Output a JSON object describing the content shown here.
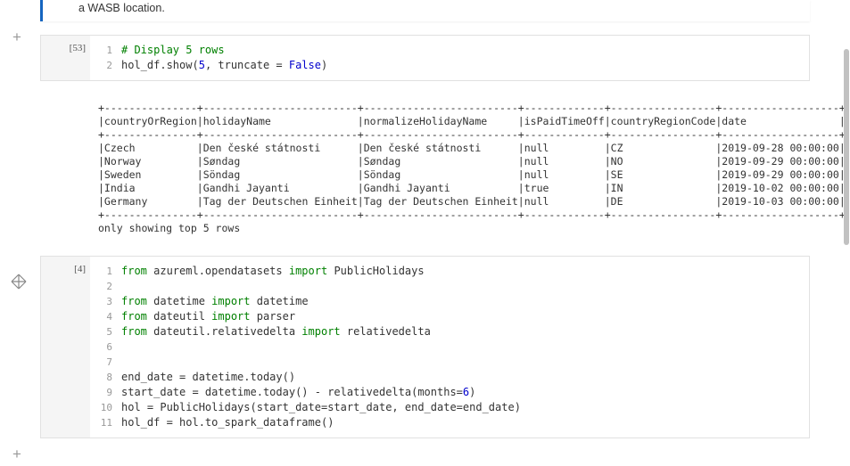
{
  "md_text": "a WASB location.",
  "cells": [
    {
      "prompt": "[53]",
      "lines": [
        {
          "n": "1",
          "tokens": [
            {
              "t": "# Display 5 rows",
              "cls": "cm-kw"
            }
          ]
        },
        {
          "n": "2",
          "tokens": [
            {
              "t": "hol_df.show("
            },
            {
              "t": "5",
              "cls": "cm-bi"
            },
            {
              "t": ", truncate = "
            },
            {
              "t": "False",
              "cls": "cm-bi"
            },
            {
              "t": ")"
            }
          ]
        }
      ]
    },
    {
      "prompt": "[4]",
      "lines": [
        {
          "n": "1",
          "tokens": [
            {
              "t": "from",
              "cls": "cm-kw"
            },
            {
              "t": " azureml.opendatasets "
            },
            {
              "t": "import",
              "cls": "cm-kw"
            },
            {
              "t": " PublicHolidays"
            }
          ]
        },
        {
          "n": "2",
          "tokens": []
        },
        {
          "n": "3",
          "tokens": [
            {
              "t": "from",
              "cls": "cm-kw"
            },
            {
              "t": " datetime "
            },
            {
              "t": "import",
              "cls": "cm-kw"
            },
            {
              "t": " datetime"
            }
          ]
        },
        {
          "n": "4",
          "tokens": [
            {
              "t": "from",
              "cls": "cm-kw"
            },
            {
              "t": " dateutil "
            },
            {
              "t": "import",
              "cls": "cm-kw"
            },
            {
              "t": " parser"
            }
          ]
        },
        {
          "n": "5",
          "tokens": [
            {
              "t": "from",
              "cls": "cm-kw"
            },
            {
              "t": " dateutil.relativedelta "
            },
            {
              "t": "import",
              "cls": "cm-kw"
            },
            {
              "t": " relativedelta"
            }
          ]
        },
        {
          "n": "6",
          "tokens": []
        },
        {
          "n": "7",
          "tokens": []
        },
        {
          "n": "8",
          "tokens": [
            {
              "t": "end_date = datetime.today()"
            }
          ]
        },
        {
          "n": "9",
          "tokens": [
            {
              "t": "start_date = datetime.today() - relativedelta(months="
            },
            {
              "t": "6",
              "cls": "cm-bi"
            },
            {
              "t": ")"
            }
          ]
        },
        {
          "n": "10",
          "tokens": [
            {
              "t": "hol = PublicHolidays(start_date=start_date, end_date=end_date)"
            }
          ]
        },
        {
          "n": "11",
          "tokens": [
            {
              "t": "hol_df = hol.to_spark_dataframe()"
            }
          ]
        }
      ]
    }
  ],
  "table": {
    "headers": [
      "countryOrRegion",
      "holidayName",
      "normalizeHolidayName",
      "isPaidTimeOff",
      "countryRegionCode",
      "date"
    ],
    "rows": [
      [
        "Czech",
        "Den české státnosti",
        "Den české státnosti",
        "null",
        "CZ",
        "2019-09-28 00:00:00"
      ],
      [
        "Norway",
        "Søndag",
        "Søndag",
        "null",
        "NO",
        "2019-09-29 00:00:00"
      ],
      [
        "Sweden",
        "Söndag",
        "Söndag",
        "null",
        "SE",
        "2019-09-29 00:00:00"
      ],
      [
        "India",
        "Gandhi Jayanti",
        "Gandhi Jayanti",
        "true",
        "IN",
        "2019-10-02 00:00:00"
      ],
      [
        "Germany",
        "Tag der Deutschen Einheit",
        "Tag der Deutschen Einheit",
        "null",
        "DE",
        "2019-10-03 00:00:00"
      ]
    ],
    "footer": "only showing top 5 rows"
  },
  "chart_data": {
    "type": "table",
    "title": "Public Holidays (top 5 rows)",
    "columns": [
      "countryOrRegion",
      "holidayName",
      "normalizeHolidayName",
      "isPaidTimeOff",
      "countryRegionCode",
      "date"
    ],
    "rows": [
      {
        "countryOrRegion": "Czech",
        "holidayName": "Den české státnosti",
        "normalizeHolidayName": "Den české státnosti",
        "isPaidTimeOff": null,
        "countryRegionCode": "CZ",
        "date": "2019-09-28 00:00:00"
      },
      {
        "countryOrRegion": "Norway",
        "holidayName": "Søndag",
        "normalizeHolidayName": "Søndag",
        "isPaidTimeOff": null,
        "countryRegionCode": "NO",
        "date": "2019-09-29 00:00:00"
      },
      {
        "countryOrRegion": "Sweden",
        "holidayName": "Söndag",
        "normalizeHolidayName": "Söndag",
        "isPaidTimeOff": null,
        "countryRegionCode": "SE",
        "date": "2019-09-29 00:00:00"
      },
      {
        "countryOrRegion": "India",
        "holidayName": "Gandhi Jayanti",
        "normalizeHolidayName": "Gandhi Jayanti",
        "isPaidTimeOff": true,
        "countryRegionCode": "IN",
        "date": "2019-10-02 00:00:00"
      },
      {
        "countryOrRegion": "Germany",
        "holidayName": "Tag der Deutschen Einheit",
        "normalizeHolidayName": "Tag der Deutschen Einheit",
        "isPaidTimeOff": null,
        "countryRegionCode": "DE",
        "date": "2019-10-03 00:00:00"
      }
    ]
  }
}
